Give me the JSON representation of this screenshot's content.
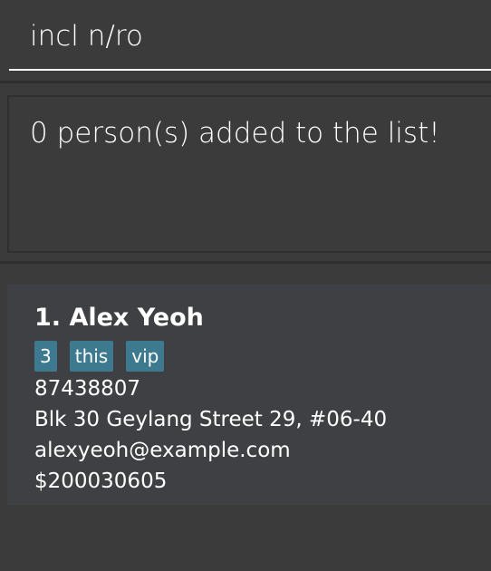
{
  "command": {
    "value": "incl n/ro"
  },
  "result": {
    "message": "0 person(s) added to the list!"
  },
  "persons": [
    {
      "name": "1. Alex Yeoh",
      "tags": [
        "3",
        "this",
        "vip"
      ],
      "phone": "87438807",
      "address": "Blk 30 Geylang Street 29, #06-40",
      "email": "alexyeoh@example.com",
      "amount": "$200030605"
    }
  ],
  "colors": {
    "background": "#3b3b3b",
    "card": "#3f4043",
    "tag": "#3d7a8f",
    "divider": "#2e2e2e",
    "text": "#ffffff"
  }
}
